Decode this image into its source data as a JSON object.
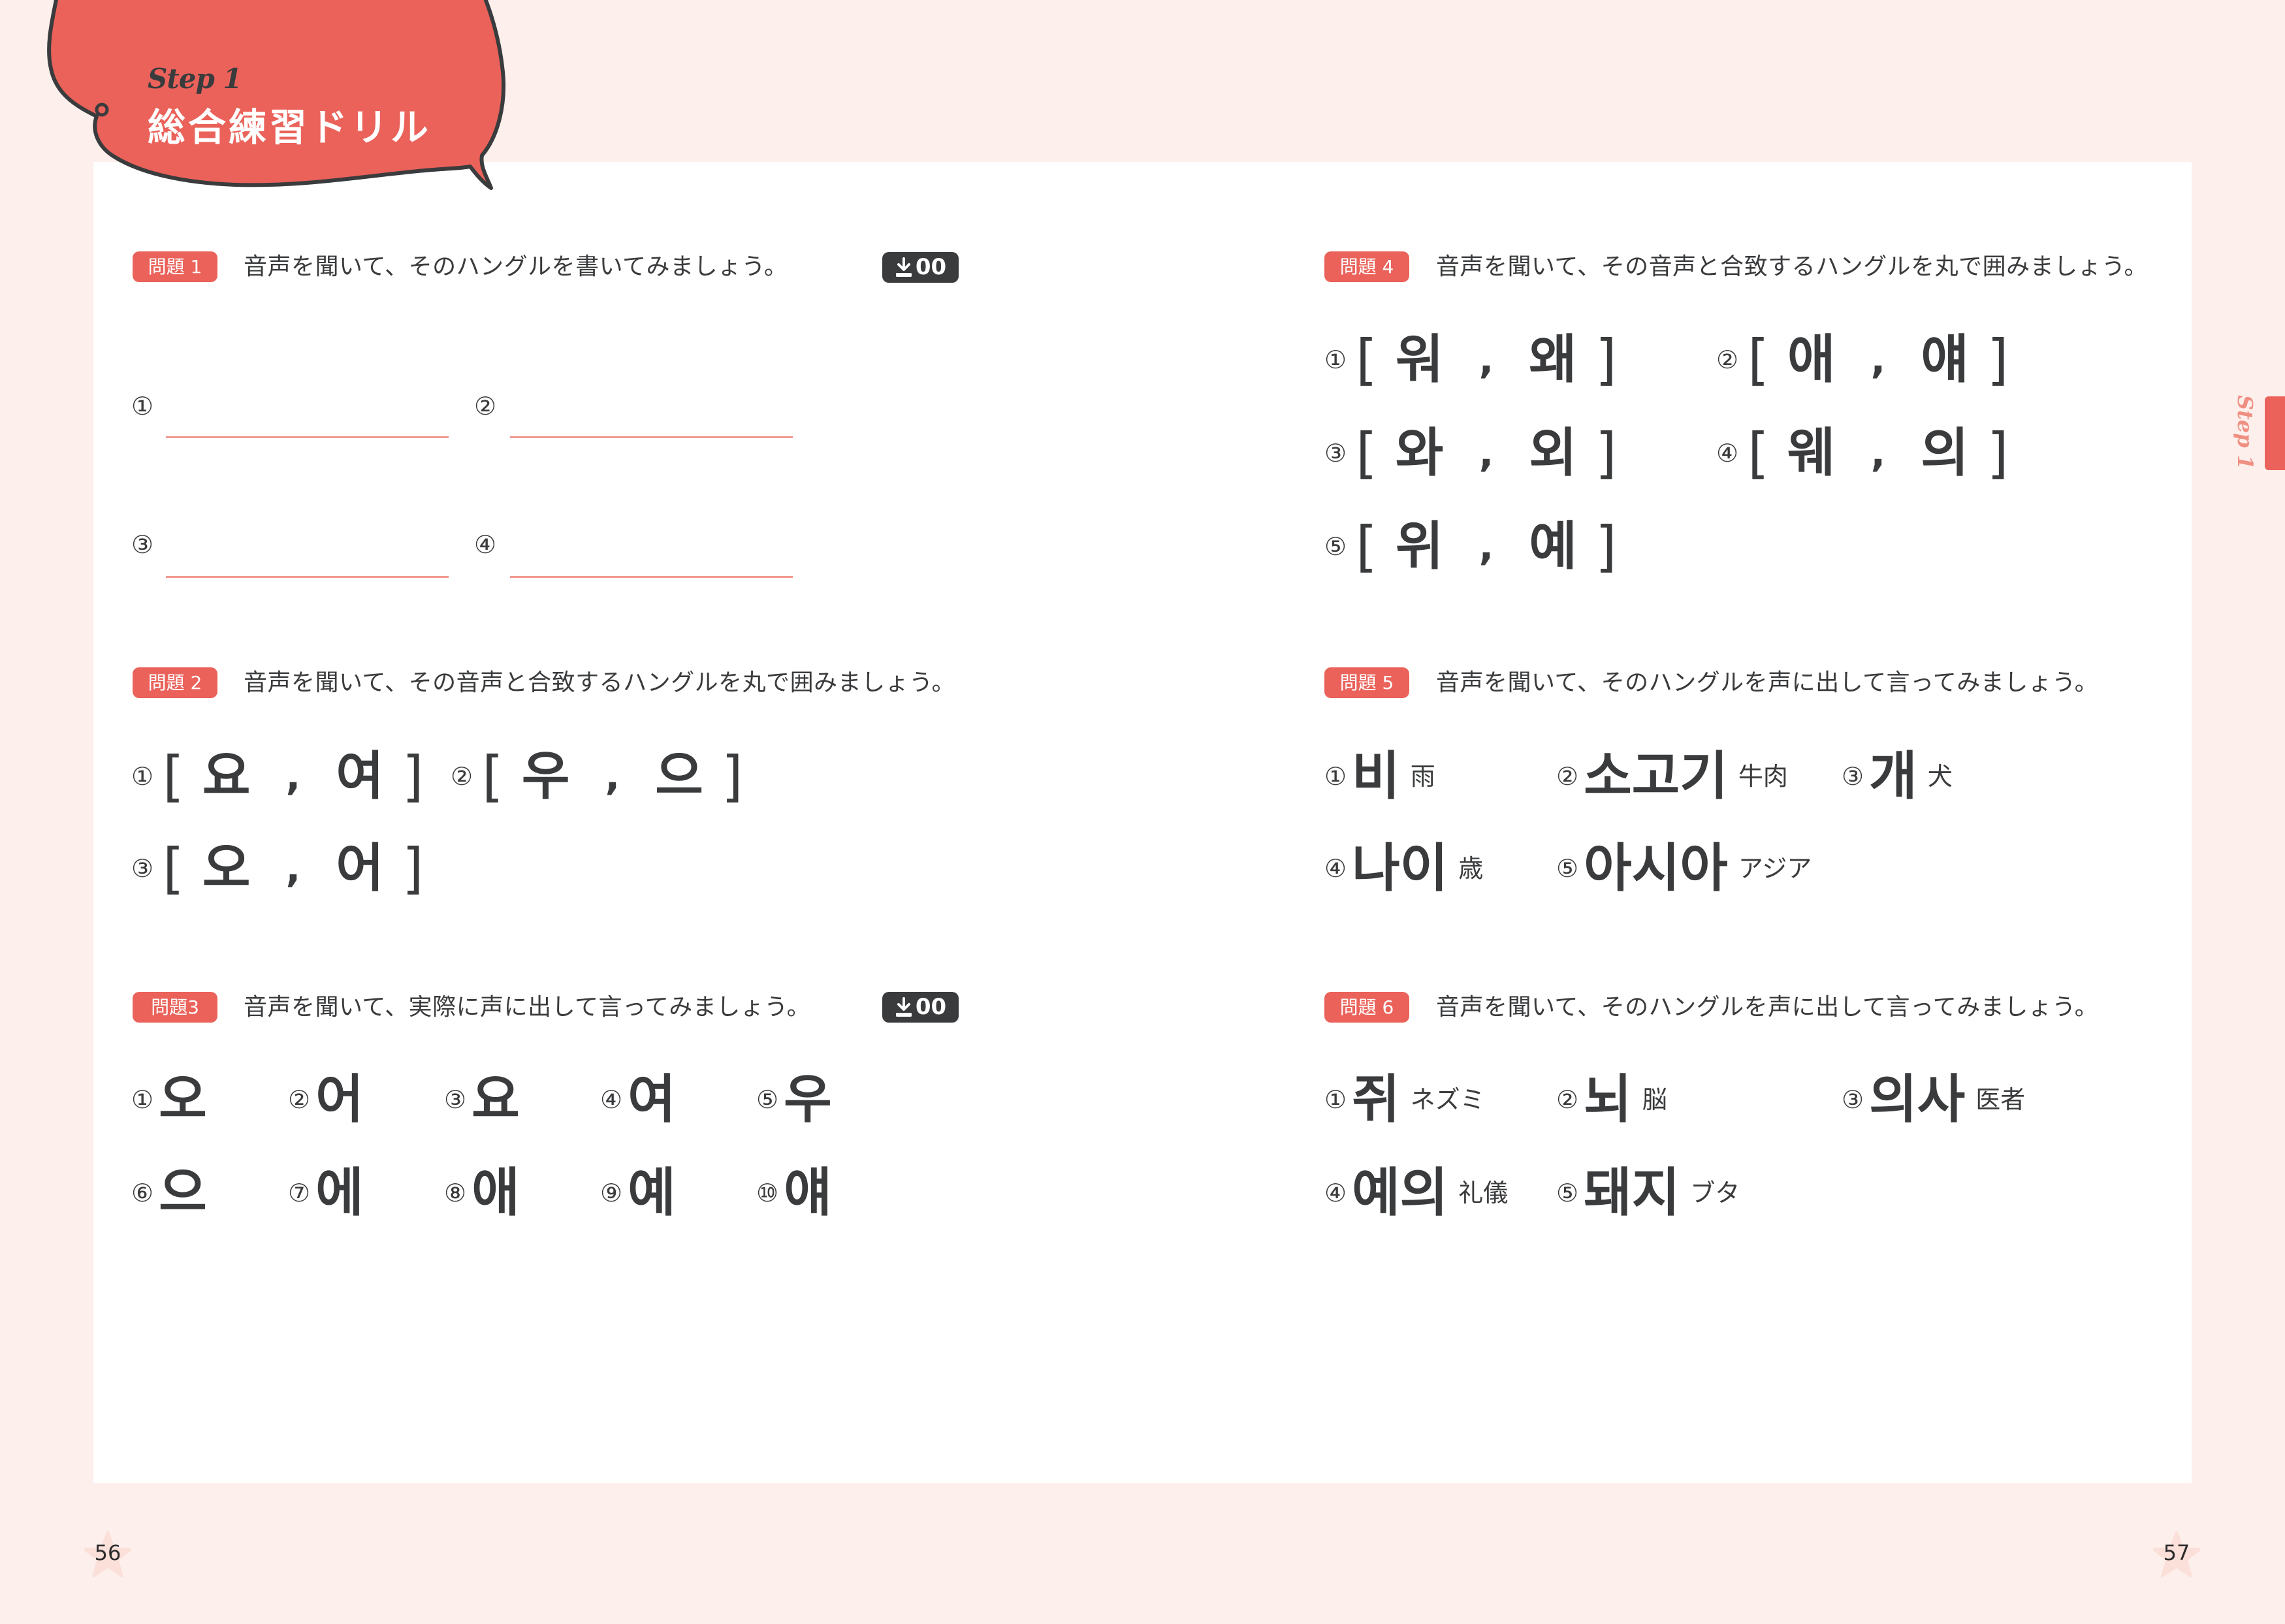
{
  "header": {
    "step_label": "Step 1",
    "title": "総合練習ドリル",
    "accent_color": "#ea625a",
    "dark_color": "#3a3b3d"
  },
  "side_tab": {
    "label": "Step 1"
  },
  "audio_icon": "download-icon",
  "questions": {
    "q1": {
      "badge": "問題 1",
      "instruction": "音声を聞いて、そのハングルを書いてみましょう。",
      "audio_track": "00",
      "items": [
        "①",
        "②",
        "③",
        "④"
      ]
    },
    "q2": {
      "badge": "問題 2",
      "instruction": "音声を聞いて、その音声と合致するハングルを丸で囲みましょう。",
      "items": [
        {
          "num": "①",
          "a": "요",
          "b": "여"
        },
        {
          "num": "②",
          "a": "우",
          "b": "으"
        },
        {
          "num": "③",
          "a": "오",
          "b": "어"
        }
      ]
    },
    "q3": {
      "badge": "問題3",
      "instruction": "音声を聞いて、実際に声に出して言ってみましょう。",
      "audio_track": "00",
      "items": [
        {
          "num": "①",
          "hangul": "오"
        },
        {
          "num": "②",
          "hangul": "어"
        },
        {
          "num": "③",
          "hangul": "요"
        },
        {
          "num": "④",
          "hangul": "여"
        },
        {
          "num": "⑤",
          "hangul": "우"
        },
        {
          "num": "⑥",
          "hangul": "으"
        },
        {
          "num": "⑦",
          "hangul": "에"
        },
        {
          "num": "⑧",
          "hangul": "애"
        },
        {
          "num": "⑨",
          "hangul": "예"
        },
        {
          "num": "⑩",
          "hangul": "얘"
        }
      ]
    },
    "q4": {
      "badge": "問題 4",
      "instruction": "音声を聞いて、その音声と合致するハングルを丸で囲みましょう。",
      "items": [
        {
          "num": "①",
          "a": "워",
          "b": "왜"
        },
        {
          "num": "②",
          "a": "애",
          "b": "얘"
        },
        {
          "num": "③",
          "a": "와",
          "b": "외"
        },
        {
          "num": "④",
          "a": "웨",
          "b": "의"
        },
        {
          "num": "⑤",
          "a": "위",
          "b": "예"
        }
      ]
    },
    "q5": {
      "badge": "問題 5",
      "instruction": "音声を聞いて、そのハングルを声に出して言ってみましょう。",
      "items": [
        {
          "num": "①",
          "hangul": "비",
          "gloss": "雨"
        },
        {
          "num": "②",
          "hangul": "소고기",
          "gloss": "牛肉"
        },
        {
          "num": "③",
          "hangul": "개",
          "gloss": "犬"
        },
        {
          "num": "④",
          "hangul": "나이",
          "gloss": "歳"
        },
        {
          "num": "⑤",
          "hangul": "아시아",
          "gloss": "アジア"
        }
      ]
    },
    "q6": {
      "badge": "問題 6",
      "instruction": "音声を聞いて、そのハングルを声に出して言ってみましょう。",
      "items": [
        {
          "num": "①",
          "hangul": "쥐",
          "gloss": "ネズミ"
        },
        {
          "num": "②",
          "hangul": "뇌",
          "gloss": "脳"
        },
        {
          "num": "③",
          "hangul": "의사",
          "gloss": "医者"
        },
        {
          "num": "④",
          "hangul": "예의",
          "gloss": "礼儀"
        },
        {
          "num": "⑤",
          "hangul": "돼지",
          "gloss": "ブタ"
        }
      ]
    }
  },
  "footer": {
    "page_left": "56",
    "page_right": "57"
  }
}
